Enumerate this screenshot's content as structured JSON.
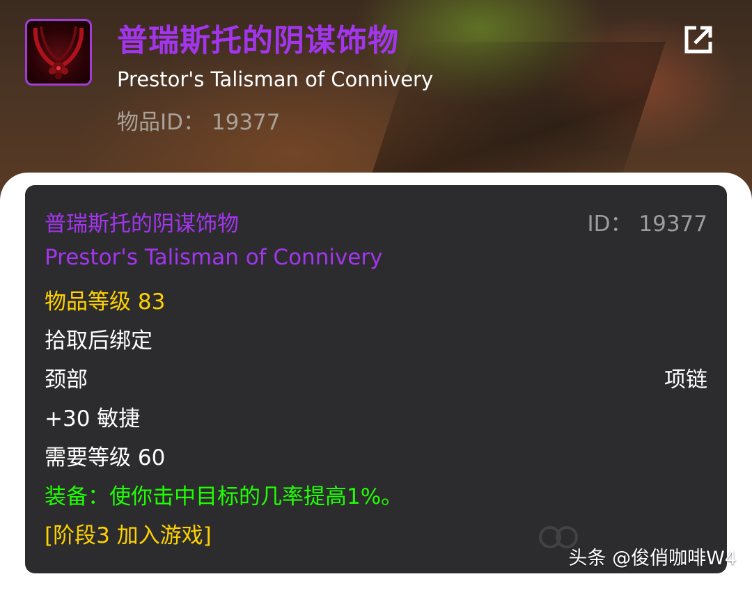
{
  "header": {
    "title_cn": "普瑞斯托的阴谋饰物",
    "title_en": "Prestor's Talisman of Connivery",
    "item_id_label": "物品ID： 19377",
    "share_icon": "external-link-icon"
  },
  "tooltip": {
    "name_cn": "普瑞斯托的阴谋饰物",
    "id_text": "ID： 19377",
    "name_en": "Prestor's Talisman of Connivery",
    "item_level": "物品等级 83",
    "binding": "拾取后绑定",
    "slot": "颈部",
    "type": "项链",
    "stat": "+30 敏捷",
    "required_level": "需要等级 60",
    "equip_effect": "装备：使你击中目标的几率提高1%。",
    "phase": "[阶段3 加入游戏]"
  },
  "footer": {
    "source_mark": "头条 @俊俏咖啡W4"
  },
  "colors": {
    "epic_purple": "#a335ee",
    "gold": "#ffd100",
    "green": "#1eff00",
    "panel_bg": "#2c2c2e"
  }
}
